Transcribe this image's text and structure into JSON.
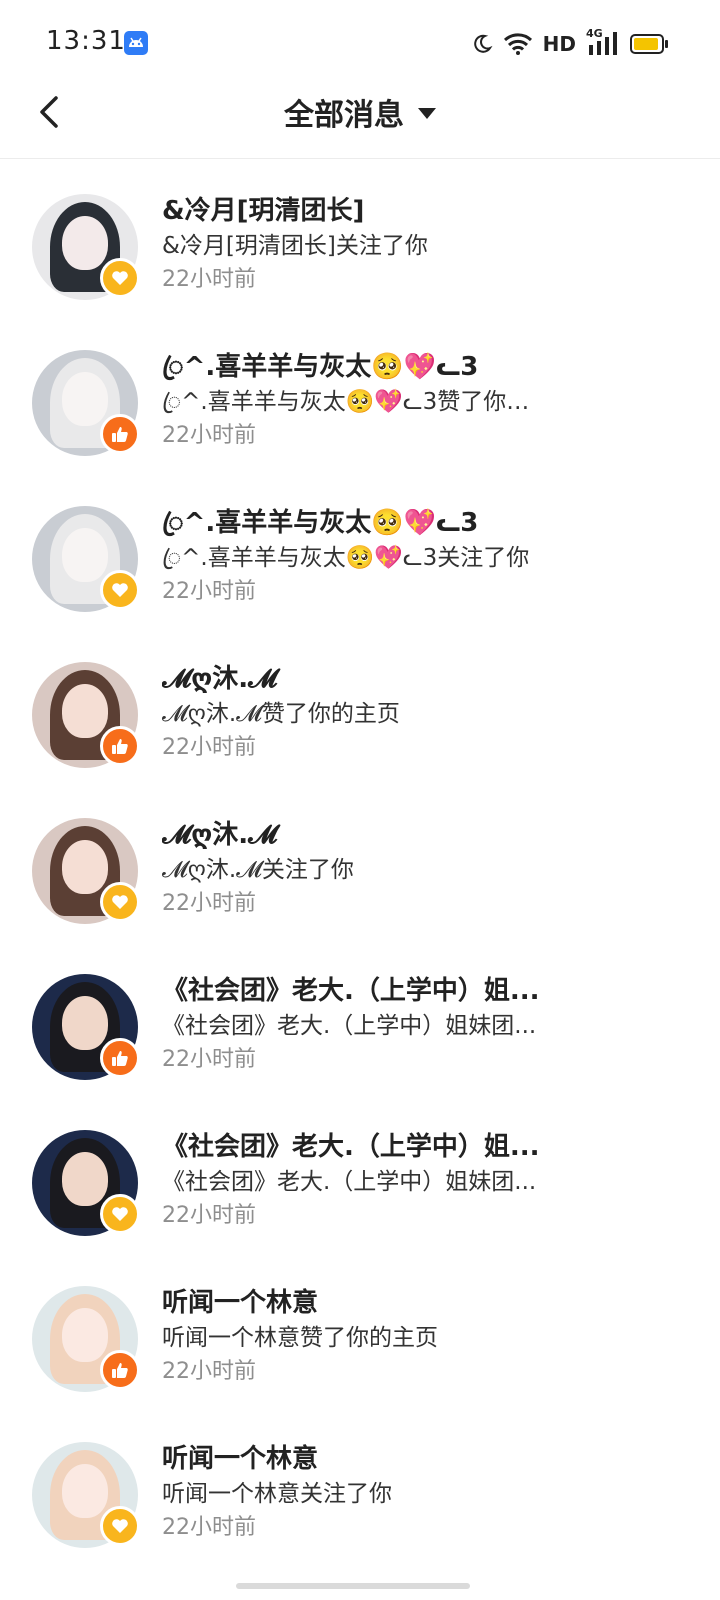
{
  "status_bar": {
    "time": "13:31",
    "network_label": "HD",
    "signal_label": "4G",
    "battery_color": "#f4c400",
    "icons": [
      "android-app-icon",
      "moon-icon",
      "wifi-icon",
      "signal-icon",
      "battery-icon"
    ]
  },
  "header": {
    "title": "全部消息",
    "back_icon": "chevron-left-icon",
    "dropdown_icon": "caret-down-icon"
  },
  "messages": [
    {
      "name": "&冷月[玥清团长]",
      "desc": "&冷月[玥清团长]关注了你",
      "time": "22小时前",
      "type": "follow",
      "avatar_palette": [
        "#e8e8ea",
        "#f3eaea",
        "#2a2f36"
      ]
    },
    {
      "name": "ꦿ^.喜羊羊与灰太🥺💖ᓚ3",
      "desc": "ꦿ^.喜羊羊与灰太🥺💖ᓚ3赞了你的...",
      "time": "22小时前",
      "type": "like",
      "avatar_palette": [
        "#c9cdd3",
        "#f7f4f3",
        "#e9e9ea"
      ]
    },
    {
      "name": "ꦿ^.喜羊羊与灰太🥺💖ᓚ3",
      "desc": "ꦿ^.喜羊羊与灰太🥺💖ᓚ3关注了你",
      "time": "22小时前",
      "type": "follow",
      "avatar_palette": [
        "#c9cdd3",
        "#f7f4f3",
        "#e9e9ea"
      ]
    },
    {
      "name": "𝓜ღ沐.𝓜",
      "desc": "𝓜ღ沐.𝓜赞了你的主页",
      "time": "22小时前",
      "type": "like",
      "avatar_palette": [
        "#d9c8c2",
        "#f5ded4",
        "#5b3f34"
      ]
    },
    {
      "name": "𝓜ღ沐.𝓜",
      "desc": "𝓜ღ沐.𝓜关注了你",
      "time": "22小时前",
      "type": "follow",
      "avatar_palette": [
        "#d9c8c2",
        "#f5ded4",
        "#5b3f34"
      ]
    },
    {
      "name": "《社会团》老大.（上学中）姐...",
      "desc": "《社会团》老大.（上学中）姐妹团...",
      "time": "22小时前",
      "type": "like",
      "avatar_palette": [
        "#1d2a4a",
        "#f0d7c9",
        "#1a1a1f"
      ]
    },
    {
      "name": "《社会团》老大.（上学中）姐...",
      "desc": "《社会团》老大.（上学中）姐妹团...",
      "time": "22小时前",
      "type": "follow",
      "avatar_palette": [
        "#1d2a4a",
        "#f0d7c9",
        "#1a1a1f"
      ]
    },
    {
      "name": "听闻一个林意",
      "desc": "听闻一个林意赞了你的主页",
      "time": "22小时前",
      "type": "like",
      "avatar_palette": [
        "#dfe8ea",
        "#fbe9e2",
        "#f1d3bd"
      ]
    },
    {
      "name": "听闻一个林意",
      "desc": "听闻一个林意关注了你",
      "time": "22小时前",
      "type": "follow",
      "avatar_palette": [
        "#dfe8ea",
        "#fbe9e2",
        "#f1d3bd"
      ]
    }
  ]
}
